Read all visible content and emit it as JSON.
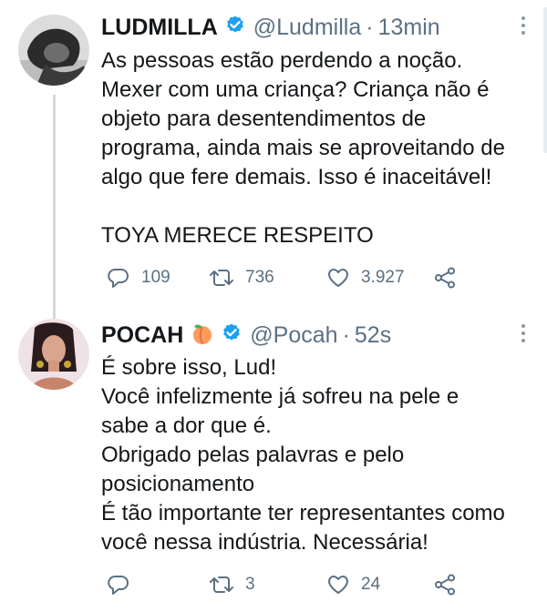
{
  "tweets": [
    {
      "name": "LUDMILLA",
      "handle": "@Ludmilla",
      "separator": "·",
      "time": "13min",
      "emoji": "",
      "verified": true,
      "lines": [
        "As pessoas estão perdendo a noção.",
        "Mexer com uma criança? Criança não é",
        "objeto para desentendimentos de",
        "programa, ainda mais se aproveitando de",
        "algo que fere demais. Isso é inaceitável!",
        "",
        "TOYA MERECE RESPEITO"
      ],
      "replies": "109",
      "retweets": "736",
      "likes": "3.927"
    },
    {
      "name": "POCAH",
      "handle": "@Pocah",
      "separator": "·",
      "time": "52s",
      "emoji": "🍑",
      "verified": true,
      "lines": [
        "É sobre isso, Lud!",
        "Você infelizmente já sofreu na pele e",
        "sabe a dor que é.",
        "Obrigado pelas palavras e pelo",
        "posicionamento",
        "É tão importante ter representantes como",
        "você nessa indústria. Necessária!"
      ],
      "replies": "",
      "retweets": "3",
      "likes": "24"
    }
  ],
  "colors": {
    "verified": "#1da1f2",
    "text": "#14171a",
    "secondary": "#5b7083",
    "thread_line": "#cfd9de"
  },
  "icons": [
    "verified-badge-icon",
    "more-icon",
    "reply-icon",
    "retweet-icon",
    "like-icon",
    "share-icon",
    "peach-emoji"
  ]
}
